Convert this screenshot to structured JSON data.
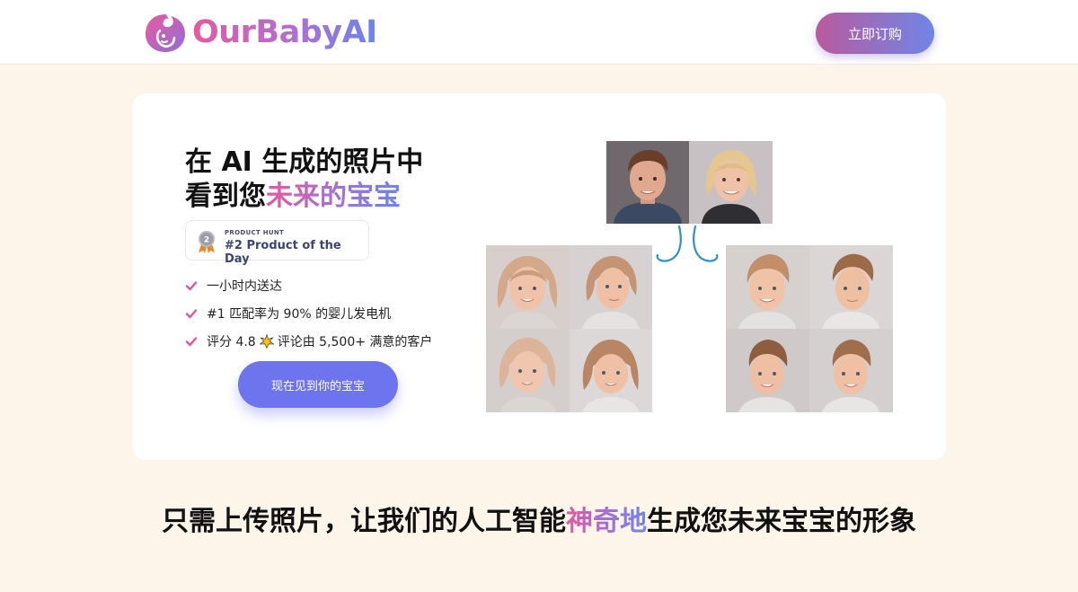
{
  "header": {
    "brand": "OurBabyAI",
    "cta_label": "立即订购"
  },
  "hero": {
    "title_line1": "在 AI 生成的照片中",
    "title_line2_plain": "看到您",
    "title_line2_highlight": "未来的宝宝",
    "badge": {
      "small": "PRODUCT HUNT",
      "big": "#2 Product of the Day",
      "medal_number": "2"
    },
    "features": [
      "一小时内送达",
      "#1 匹配率为 90% 的婴儿发电机",
      "评分 4.8",
      "评论由 5,500+ 满意的客户"
    ],
    "cta_label": "现在见到你的宝宝"
  },
  "tagline": {
    "before": "只需上传照片，让我们的人工智能",
    "highlight": "神奇地",
    "after": "生成您未来宝宝的形象"
  },
  "colors": {
    "accent_pink": "#e2599f",
    "accent_blue": "#6e84ee",
    "cta_blue": "#6e74ee",
    "check_pink": "#e0569a",
    "page_bg": "#fdf5ea"
  },
  "icons": {
    "logo": "baby-face-logo-icon",
    "medal": "medal-icon",
    "check": "check-icon",
    "star": "sparkle-star-icon"
  }
}
